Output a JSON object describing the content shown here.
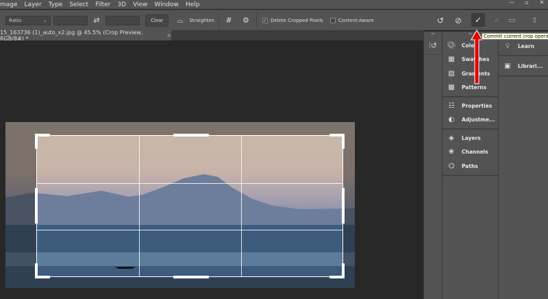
{
  "menu": [
    "mage",
    "Layer",
    "Type",
    "Select",
    "Filter",
    "3D",
    "View",
    "Window",
    "Help"
  ],
  "window_controls": [
    "minimize",
    "maximize",
    "close"
  ],
  "options": {
    "ratio": "Ratio",
    "width_value": "",
    "height_value": "",
    "swap_icon": "swap-arrows-icon",
    "clear": "Clear",
    "straighten": "Straighten",
    "delete_cropped": "Delete Cropped Pixels",
    "delete_cropped_checked": true,
    "content_aware": "Content-Aware",
    "content_aware_checked": false
  },
  "document_tab": {
    "title": "15_163736 (1)_auto_x2.jpg @ 45.5% (Crop Preview, RGB/8#) *",
    "close": "×"
  },
  "tooltip": "Commit current crop operation",
  "panels": {
    "group1": [
      {
        "icon": "color-palette-icon",
        "label": "Color"
      },
      {
        "icon": "swatches-icon",
        "label": "Swatches"
      },
      {
        "icon": "gradients-icon",
        "label": "Gradients"
      },
      {
        "icon": "patterns-icon",
        "label": "Patterns"
      }
    ],
    "group2": [
      {
        "icon": "properties-icon",
        "label": "Properties"
      },
      {
        "icon": "adjustments-icon",
        "label": "Adjustme..."
      }
    ],
    "group3": [
      {
        "icon": "layers-icon",
        "label": "Layers"
      },
      {
        "icon": "channels-icon",
        "label": "Channels"
      },
      {
        "icon": "paths-icon",
        "label": "Paths"
      }
    ],
    "right": [
      {
        "icon": "lightbulb-icon",
        "label": "Learn"
      },
      {
        "icon": "libraries-icon",
        "label": "Librari..."
      }
    ]
  },
  "annotation_color": "#e00000"
}
